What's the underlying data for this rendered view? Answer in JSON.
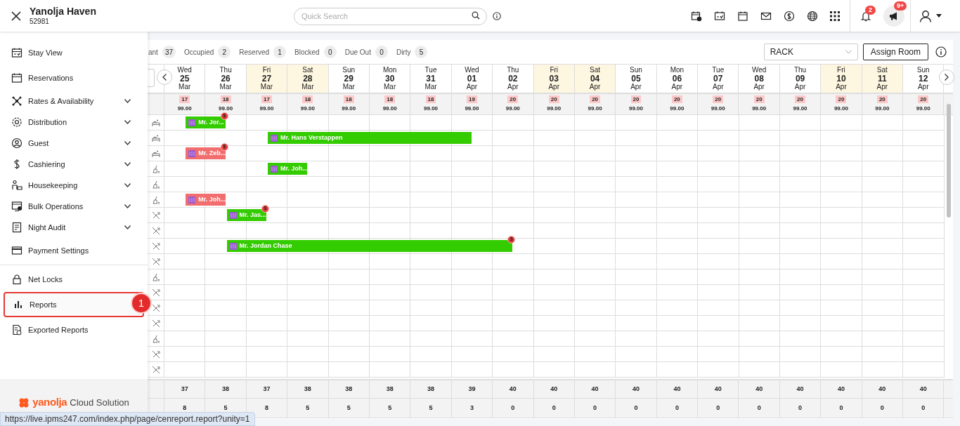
{
  "header": {
    "hotel_name": "Yanolja Haven",
    "hotel_id": "52981",
    "search": {
      "placeholder": "Quick Search"
    },
    "notifications": {
      "bell_badge": "2",
      "announcement_badge": "9+"
    }
  },
  "sidebar": {
    "items": [
      {
        "label": "Stay View",
        "expandable": false,
        "selected": false
      },
      {
        "label": "Reservations",
        "expandable": false,
        "selected": false
      },
      {
        "label": "Rates & Availability",
        "expandable": true,
        "selected": false
      },
      {
        "label": "Distribution",
        "expandable": true,
        "selected": false
      },
      {
        "label": "Guest",
        "expandable": true,
        "selected": false
      },
      {
        "label": "Cashiering",
        "expandable": true,
        "selected": false
      },
      {
        "label": "Housekeeping",
        "expandable": true,
        "selected": false
      },
      {
        "label": "Bulk Operations",
        "expandable": true,
        "selected": false
      },
      {
        "label": "Night Audit",
        "expandable": true,
        "selected": false
      },
      {
        "label": "Payment Settings",
        "expandable": false,
        "selected": false
      },
      {
        "label": "Net Locks",
        "expandable": false,
        "selected": false
      },
      {
        "label": "Reports",
        "expandable": false,
        "selected": true,
        "step_badge": "1"
      },
      {
        "label": "Exported Reports",
        "expandable": false,
        "selected": false
      }
    ],
    "logo": {
      "brand": "yanolja",
      "tagline": "Cloud Solution"
    }
  },
  "stats": [
    {
      "label": "ant",
      "value": "37"
    },
    {
      "label": "Occupied",
      "value": "2"
    },
    {
      "label": "Reserved",
      "value": "1"
    },
    {
      "label": "Blocked",
      "value": "0"
    },
    {
      "label": "Due Out",
      "value": "0"
    },
    {
      "label": "Dirty",
      "value": "5"
    }
  ],
  "rate_select": {
    "value": "RACK"
  },
  "assign_button": "Assign Room",
  "dates": [
    {
      "day": "Wed",
      "date": "25",
      "month": "Mar",
      "weekend": false,
      "available": "17",
      "rate": "99.00",
      "total": "37",
      "count": "8"
    },
    {
      "day": "Thu",
      "date": "26",
      "month": "Mar",
      "weekend": false,
      "available": "18",
      "rate": "99.00",
      "total": "38",
      "count": "5"
    },
    {
      "day": "Fri",
      "date": "27",
      "month": "Mar",
      "weekend": true,
      "available": "17",
      "rate": "99.00",
      "total": "37",
      "count": "8"
    },
    {
      "day": "Sat",
      "date": "28",
      "month": "Mar",
      "weekend": true,
      "available": "18",
      "rate": "99.00",
      "total": "38",
      "count": "5"
    },
    {
      "day": "Sun",
      "date": "29",
      "month": "Mar",
      "weekend": false,
      "available": "18",
      "rate": "99.00",
      "total": "38",
      "count": "5"
    },
    {
      "day": "Mon",
      "date": "30",
      "month": "Mar",
      "weekend": false,
      "available": "18",
      "rate": "99.00",
      "total": "38",
      "count": "5"
    },
    {
      "day": "Tue",
      "date": "31",
      "month": "Mar",
      "weekend": false,
      "available": "18",
      "rate": "99.00",
      "total": "38",
      "count": "5"
    },
    {
      "day": "Wed",
      "date": "01",
      "month": "Apr",
      "weekend": false,
      "available": "19",
      "rate": "99.00",
      "total": "39",
      "count": "3"
    },
    {
      "day": "Thu",
      "date": "02",
      "month": "Apr",
      "weekend": false,
      "available": "20",
      "rate": "99.00",
      "total": "40",
      "count": "0"
    },
    {
      "day": "Fri",
      "date": "03",
      "month": "Apr",
      "weekend": true,
      "available": "20",
      "rate": "99.00",
      "total": "40",
      "count": "0"
    },
    {
      "day": "Sat",
      "date": "04",
      "month": "Apr",
      "weekend": true,
      "available": "20",
      "rate": "99.00",
      "total": "40",
      "count": "0"
    },
    {
      "day": "Sun",
      "date": "05",
      "month": "Apr",
      "weekend": false,
      "available": "20",
      "rate": "99.00",
      "total": "40",
      "count": "0"
    },
    {
      "day": "Mon",
      "date": "06",
      "month": "Apr",
      "weekend": false,
      "available": "20",
      "rate": "99.00",
      "total": "40",
      "count": "0"
    },
    {
      "day": "Tue",
      "date": "07",
      "month": "Apr",
      "weekend": false,
      "available": "20",
      "rate": "99.00",
      "total": "40",
      "count": "0"
    },
    {
      "day": "Wed",
      "date": "08",
      "month": "Apr",
      "weekend": false,
      "available": "20",
      "rate": "99.00",
      "total": "40",
      "count": "0"
    },
    {
      "day": "Thu",
      "date": "09",
      "month": "Apr",
      "weekend": false,
      "available": "20",
      "rate": "99.00",
      "total": "40",
      "count": "0"
    },
    {
      "day": "Fri",
      "date": "10",
      "month": "Apr",
      "weekend": true,
      "available": "20",
      "rate": "99.00",
      "total": "40",
      "count": "0"
    },
    {
      "day": "Sat",
      "date": "11",
      "month": "Apr",
      "weekend": true,
      "available": "20",
      "rate": "99.00",
      "total": "40",
      "count": "0"
    },
    {
      "day": "Sun",
      "date": "12",
      "month": "Apr",
      "weekend": false,
      "available": "20",
      "rate": "99.00",
      "total": "40",
      "count": "0"
    }
  ],
  "rooms": [
    {
      "kind": "clean",
      "bookings": [
        {
          "guest": "Mr. Jor...",
          "color": "#33cc00",
          "payment_badge": "$"
        }
      ]
    },
    {
      "kind": "clean",
      "bookings": [
        {
          "guest": "Mr. Hans Verstappen",
          "color": "#33cc00"
        }
      ]
    },
    {
      "kind": "clean",
      "bookings": [
        {
          "guest": "Mr. Zeb...",
          "color": "#f26d6d",
          "payment_badge": "$"
        }
      ]
    },
    {
      "kind": "dirty",
      "bookings": [
        {
          "guest": "Mr. Joh...",
          "color": "#33cc00"
        }
      ]
    },
    {
      "kind": "dirty"
    },
    {
      "kind": "dirty",
      "bookings": [
        {
          "guest": "Mr. Joh...",
          "color": "#f26d6d"
        }
      ]
    },
    {
      "kind": "blocked",
      "bookings": [
        {
          "guest": "Mr. Jas...",
          "color": "#33cc00",
          "payment_badge": "$"
        }
      ]
    },
    {
      "kind": "blocked"
    },
    {
      "kind": "blocked",
      "bookings": [
        {
          "guest": "Mr. Jordan Chase",
          "color": "#33cc00",
          "payment_badge": "$"
        }
      ]
    },
    {
      "kind": "blocked"
    },
    {
      "kind": "dirty"
    },
    {
      "kind": "blocked"
    },
    {
      "kind": "blocked"
    },
    {
      "kind": "blocked"
    },
    {
      "kind": "dirty"
    },
    {
      "kind": "blocked"
    },
    {
      "kind": "blocked"
    }
  ],
  "status_url": "https://live.ipms247.com/index.php/page/cenreport.report?unity=1"
}
